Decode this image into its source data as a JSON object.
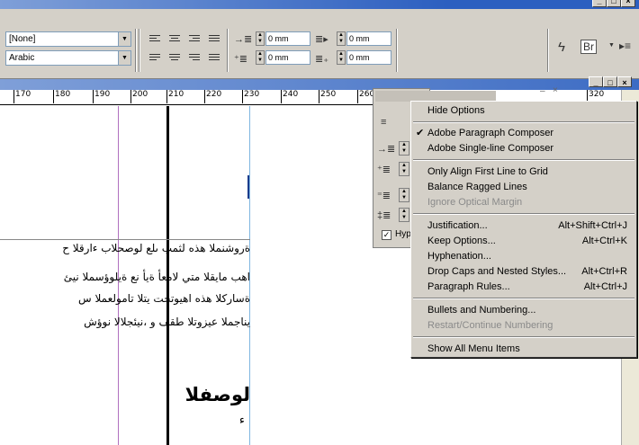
{
  "toolbar": {
    "style_value": "[None]",
    "language_value": "Arabic",
    "left_indent": "0 mm",
    "right_indent": "0 mm",
    "first_line_indent": "0 mm",
    "last_line_indent": "0 mm",
    "space_before": "0 mm",
    "space_after": "0 mm"
  },
  "ruler": {
    "ticks": [
      "170",
      "180",
      "190",
      "200",
      "210",
      "220",
      "230",
      "240",
      "250",
      "260",
      "320"
    ]
  },
  "document": {
    "lines": [
      "ةروشنملا هذه لثمب ىلع لوصحلاب ءارقلا ح",
      "اهب مايقلا متي لامعأ ةيأ نع ةيلوؤسملا نيئ",
      "ةساركلا هذه اهيوتحت يتلا تامولعملا س",
      "يناجملا عيزوتلا طقف و ،نيئجلالا نوؤش"
    ],
    "heading": "لوصفلا",
    "mark": "ء"
  },
  "panel": {
    "checkbox_label": "Hyp"
  },
  "menu": {
    "items": [
      {
        "label": "Hide Options",
        "shortcut": "",
        "disabled": false,
        "checked": false
      },
      {
        "label": "Adobe Paragraph Composer",
        "shortcut": "",
        "disabled": false,
        "checked": true
      },
      {
        "label": "Adobe Single-line Composer",
        "shortcut": "",
        "disabled": false,
        "checked": false
      },
      {
        "label": "Only Align First Line to Grid",
        "shortcut": "",
        "disabled": false,
        "checked": false
      },
      {
        "label": "Balance Ragged Lines",
        "shortcut": "",
        "disabled": false,
        "checked": false
      },
      {
        "label": "Ignore Optical Margin",
        "shortcut": "",
        "disabled": true,
        "checked": false
      },
      {
        "label": "Justification...",
        "shortcut": "Alt+Shift+Ctrl+J",
        "disabled": false,
        "checked": false
      },
      {
        "label": "Keep Options...",
        "shortcut": "Alt+Ctrl+K",
        "disabled": false,
        "checked": false
      },
      {
        "label": "Hyphenation...",
        "shortcut": "",
        "disabled": false,
        "checked": false
      },
      {
        "label": "Drop Caps and Nested Styles...",
        "shortcut": "Alt+Ctrl+R",
        "disabled": false,
        "checked": false
      },
      {
        "label": "Paragraph Rules...",
        "shortcut": "Alt+Ctrl+J",
        "disabled": false,
        "checked": false
      },
      {
        "label": "Bullets and Numbering...",
        "shortcut": "",
        "disabled": false,
        "checked": false
      },
      {
        "label": "Restart/Continue Numbering",
        "shortcut": "",
        "disabled": true,
        "checked": false
      },
      {
        "label": "Show All Menu Items",
        "shortcut": "",
        "disabled": false,
        "checked": false
      }
    ]
  },
  "colors": {
    "title_blue": "#2c5fc0",
    "chrome": "#d4d0c8",
    "guide_magenta": "#b070c0",
    "guide_cyan": "#7fb6e0"
  },
  "icons": [
    "minimize-icon",
    "maximize-icon",
    "close-icon",
    "lightning-icon",
    "bridge-icon",
    "panel-menu-icon"
  ]
}
